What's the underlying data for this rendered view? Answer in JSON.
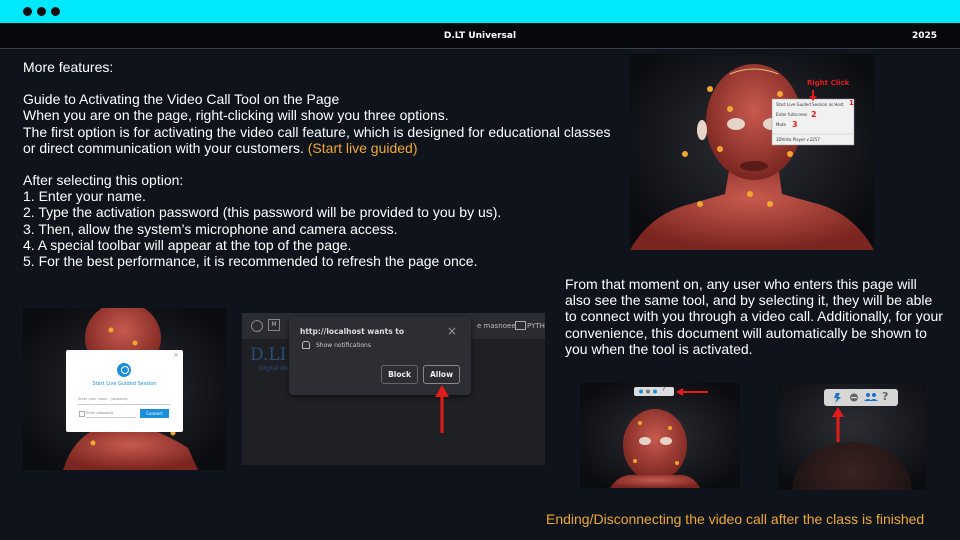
{
  "window": {
    "title": "D.LT Universal",
    "year": "2025"
  },
  "main": {
    "heading": "More features:",
    "guide_title": "Guide to Activating the Video Call Tool on the Page",
    "guide_line1": "When you are on the page, right-clicking will show you three options.",
    "guide_line2": "The first option is for activating the video call feature, which is designed for educational classes or direct communication with your customers.",
    "guide_highlight": "(Start live guided)",
    "steps_intro": "After selecting this option:",
    "steps": [
      "1. Enter your name.",
      "2. Type the activation password (this password will be provided to you by us).",
      "3. Then, allow the system’s microphone and camera access.",
      "4. A special toolbar will appear at the top of the page.",
      "5. For the best performance, it is recommended to refresh the page once."
    ]
  },
  "right": {
    "description": "From that moment on, any user who enters this page will also see the same tool, and by selecting it, they will be able to connect with you through a video call. Additionally, for your convenience, this document will automatically be shown to you when the tool is activated.",
    "footer": "Ending/Disconnecting the video call after the class is finished"
  },
  "context_menu": {
    "label": "Right Click",
    "items": [
      "Start Live Guided Session as Host",
      "Enter fullscreen",
      "Mute",
      "3DVisto Player v.2257"
    ],
    "numbers": [
      "1",
      "2",
      "3"
    ]
  },
  "login_dialog": {
    "title": "Start Live Guided Session",
    "name_placeholder": "Enter your name - (optional)",
    "password_placeholder": "Enter password",
    "connect_label": "Connect",
    "close_symbol": "×"
  },
  "permission_prompt": {
    "site": "http://localhost wants to",
    "request": "Show notifications",
    "block_label": "Block",
    "allow_label": "Allow",
    "close_symbol": "×",
    "bg_logo": "D.LI",
    "bg_subtitle": "Digital Ide",
    "tab_left": "M",
    "tab_mid": "e masnoee",
    "tab_right": "PYTH"
  },
  "toolbar": {
    "icons": [
      "phone-icon",
      "minus-circle-icon",
      "group-icon",
      "help-icon"
    ],
    "help_symbol": "?"
  },
  "colors": {
    "topbar": "#00e8fb",
    "accent": "#f0a830",
    "arrow": "#e41b1b",
    "connect_button": "#1a8fdc"
  }
}
